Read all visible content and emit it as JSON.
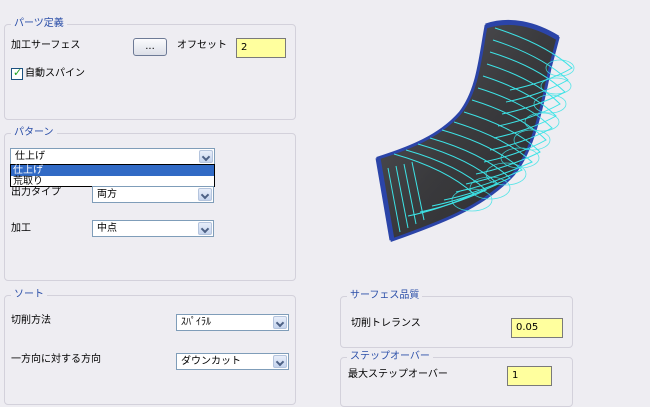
{
  "parts": {
    "title": "パーツ定義",
    "surface_label": "加工サーフェス",
    "surface_button": "...",
    "offset_label": "オフセット",
    "offset_value": "2",
    "auto_spine_label": "自動スパイン",
    "auto_spine_checked": true
  },
  "pattern": {
    "title": "パターン",
    "type_value": "仕上げ",
    "dropdown_options": [
      "仕上げ",
      "荒取り"
    ],
    "dropdown_selected": "仕上げ",
    "output_label": "出力タイプ",
    "output_value": "両方",
    "machining_label": "加工",
    "machining_value": "中点"
  },
  "sort": {
    "title": "ソート",
    "cut_method_label": "切削方法",
    "cut_method_value": "ｽﾊﾟｲﾗﾙ",
    "direction_label": "一方向に対する方向",
    "direction_value": "ダウンカット"
  },
  "surface_quality": {
    "title": "サーフェス品質",
    "tolerance_label": "切削トレランス",
    "tolerance_value": "0.05"
  },
  "stepover": {
    "title": "ステップオーバー",
    "max_label": "最大ステップオーバー",
    "max_value": "1"
  },
  "colors": {
    "group_title": "#2a4ea8",
    "field_yellow": "#ffff9e",
    "toolpath_cyan": "#3de3e6",
    "surface_dark": "#3d3d40",
    "surface_edge": "#2b44a8"
  }
}
